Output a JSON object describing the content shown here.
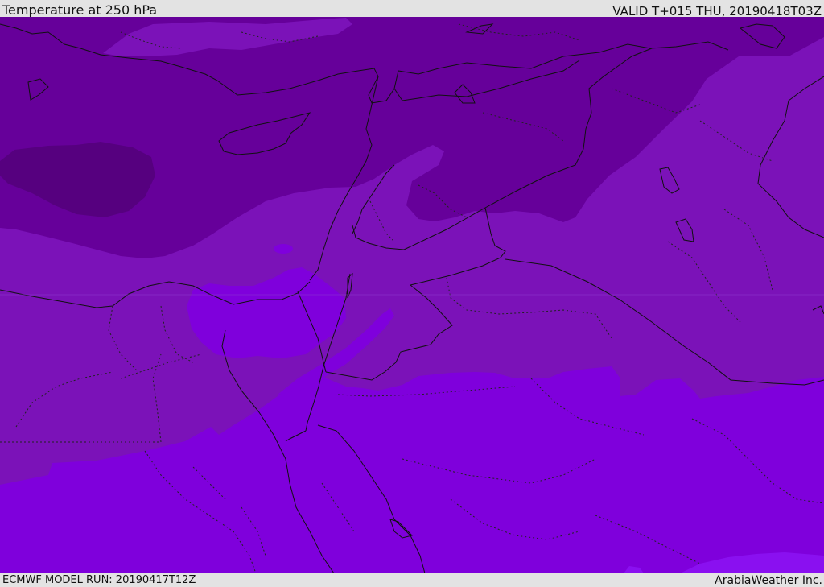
{
  "header": {
    "title": "Temperature at 250 hPa",
    "valid": "VALID T+015 THU, 20190418T03Z"
  },
  "footer": {
    "model_run": "ECMWF MODEL RUN: 20190417T12Z",
    "credit": "ArabiaWeather Inc."
  },
  "colors": {
    "darkest": "#56007f",
    "darker": "#66009a",
    "mid": "#7b12b8",
    "light": "#7f00dc",
    "lightest": "#8a10f0",
    "background_bar": "#e3e3e3"
  }
}
